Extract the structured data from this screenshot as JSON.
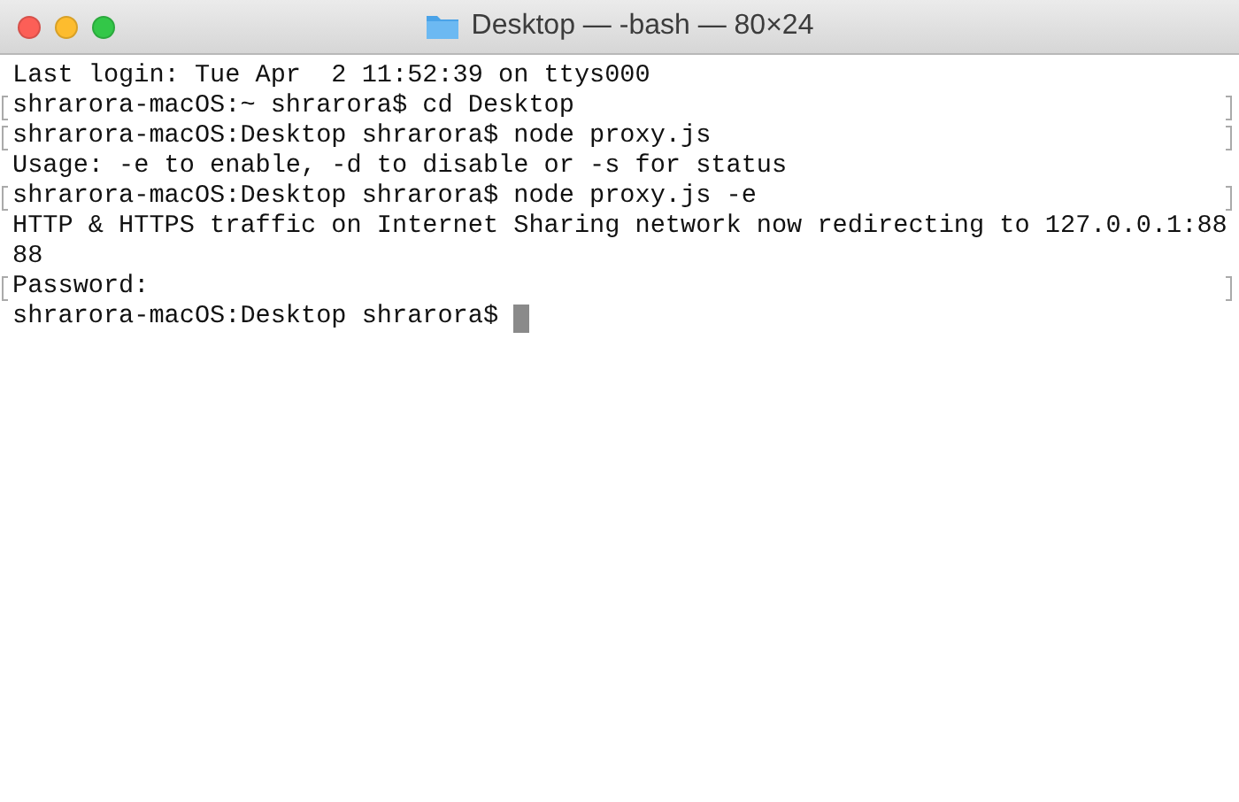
{
  "window": {
    "title": "Desktop — -bash — 80×24"
  },
  "lines": [
    {
      "text": "Last login: Tue Apr  2 11:52:39 on ttys000",
      "marked": false,
      "cursor": false
    },
    {
      "text": "shrarora-macOS:~ shrarora$ cd Desktop",
      "marked": true,
      "cursor": false
    },
    {
      "text": "shrarora-macOS:Desktop shrarora$ node proxy.js",
      "marked": true,
      "cursor": false
    },
    {
      "text": "Usage: -e to enable, -d to disable or -s for status",
      "marked": false,
      "cursor": false
    },
    {
      "text": "shrarora-macOS:Desktop shrarora$ node proxy.js -e",
      "marked": true,
      "cursor": false
    },
    {
      "text": "HTTP & HTTPS traffic on Internet Sharing network now redirecting to 127.0.0.1:88",
      "marked": false,
      "cursor": false
    },
    {
      "text": "88",
      "marked": false,
      "cursor": false
    },
    {
      "text": "Password:",
      "marked": true,
      "cursor": false
    },
    {
      "text": "shrarora-macOS:Desktop shrarora$",
      "marked": false,
      "cursor": true
    }
  ]
}
